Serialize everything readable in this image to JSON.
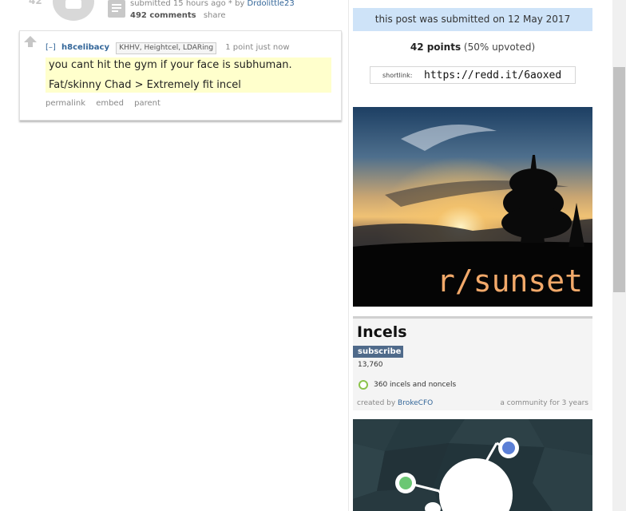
{
  "post": {
    "score": "42",
    "tagline_prefix": "submitted 15 hours ago * by ",
    "author": "Drdolittle23",
    "comments_label": "492 comments",
    "share_label": "share"
  },
  "comment": {
    "collapse_label": "[–]",
    "author": "h8celibacy",
    "flair": "KHHV, Heightcel, LDARing",
    "points": "1 point just now",
    "body_lines": [
      "you cant hit the gym if your face is subhuman.",
      "Fat/skinny Chad > Extremely fit incel"
    ],
    "buttons": [
      "permalink",
      "embed",
      "parent"
    ]
  },
  "sidebar": {
    "submitted_banner": "this post was submitted on 12 May 2017",
    "points_bold": "42 points",
    "points_rest": " (50% upvoted)",
    "shortlink_label": "shortlink:",
    "shortlink_url": "https://redd.it/6aoxed",
    "ad_caption": "r/sunset",
    "subreddit": {
      "name": "Incels",
      "subscribe_label": "subscribe",
      "subscribers": "13,760",
      "online": "360 incels and noncels",
      "created_prefix": "created by ",
      "creator": "BrokeCFO",
      "age": "a community for 3 years"
    }
  },
  "colors": {
    "link": "#336699",
    "banner": "#cee3f8",
    "comment_highlight": "#ffffcc",
    "subscribe_button": "#4f6a8a",
    "online_dot": "#8bc34a",
    "ad_caption": "#f2a96a"
  },
  "icons": {
    "upvote": "up-arrow-icon",
    "thumbnail": "comment-bubble-icon",
    "expando": "text-post-icon",
    "online": "online-dot-icon"
  }
}
